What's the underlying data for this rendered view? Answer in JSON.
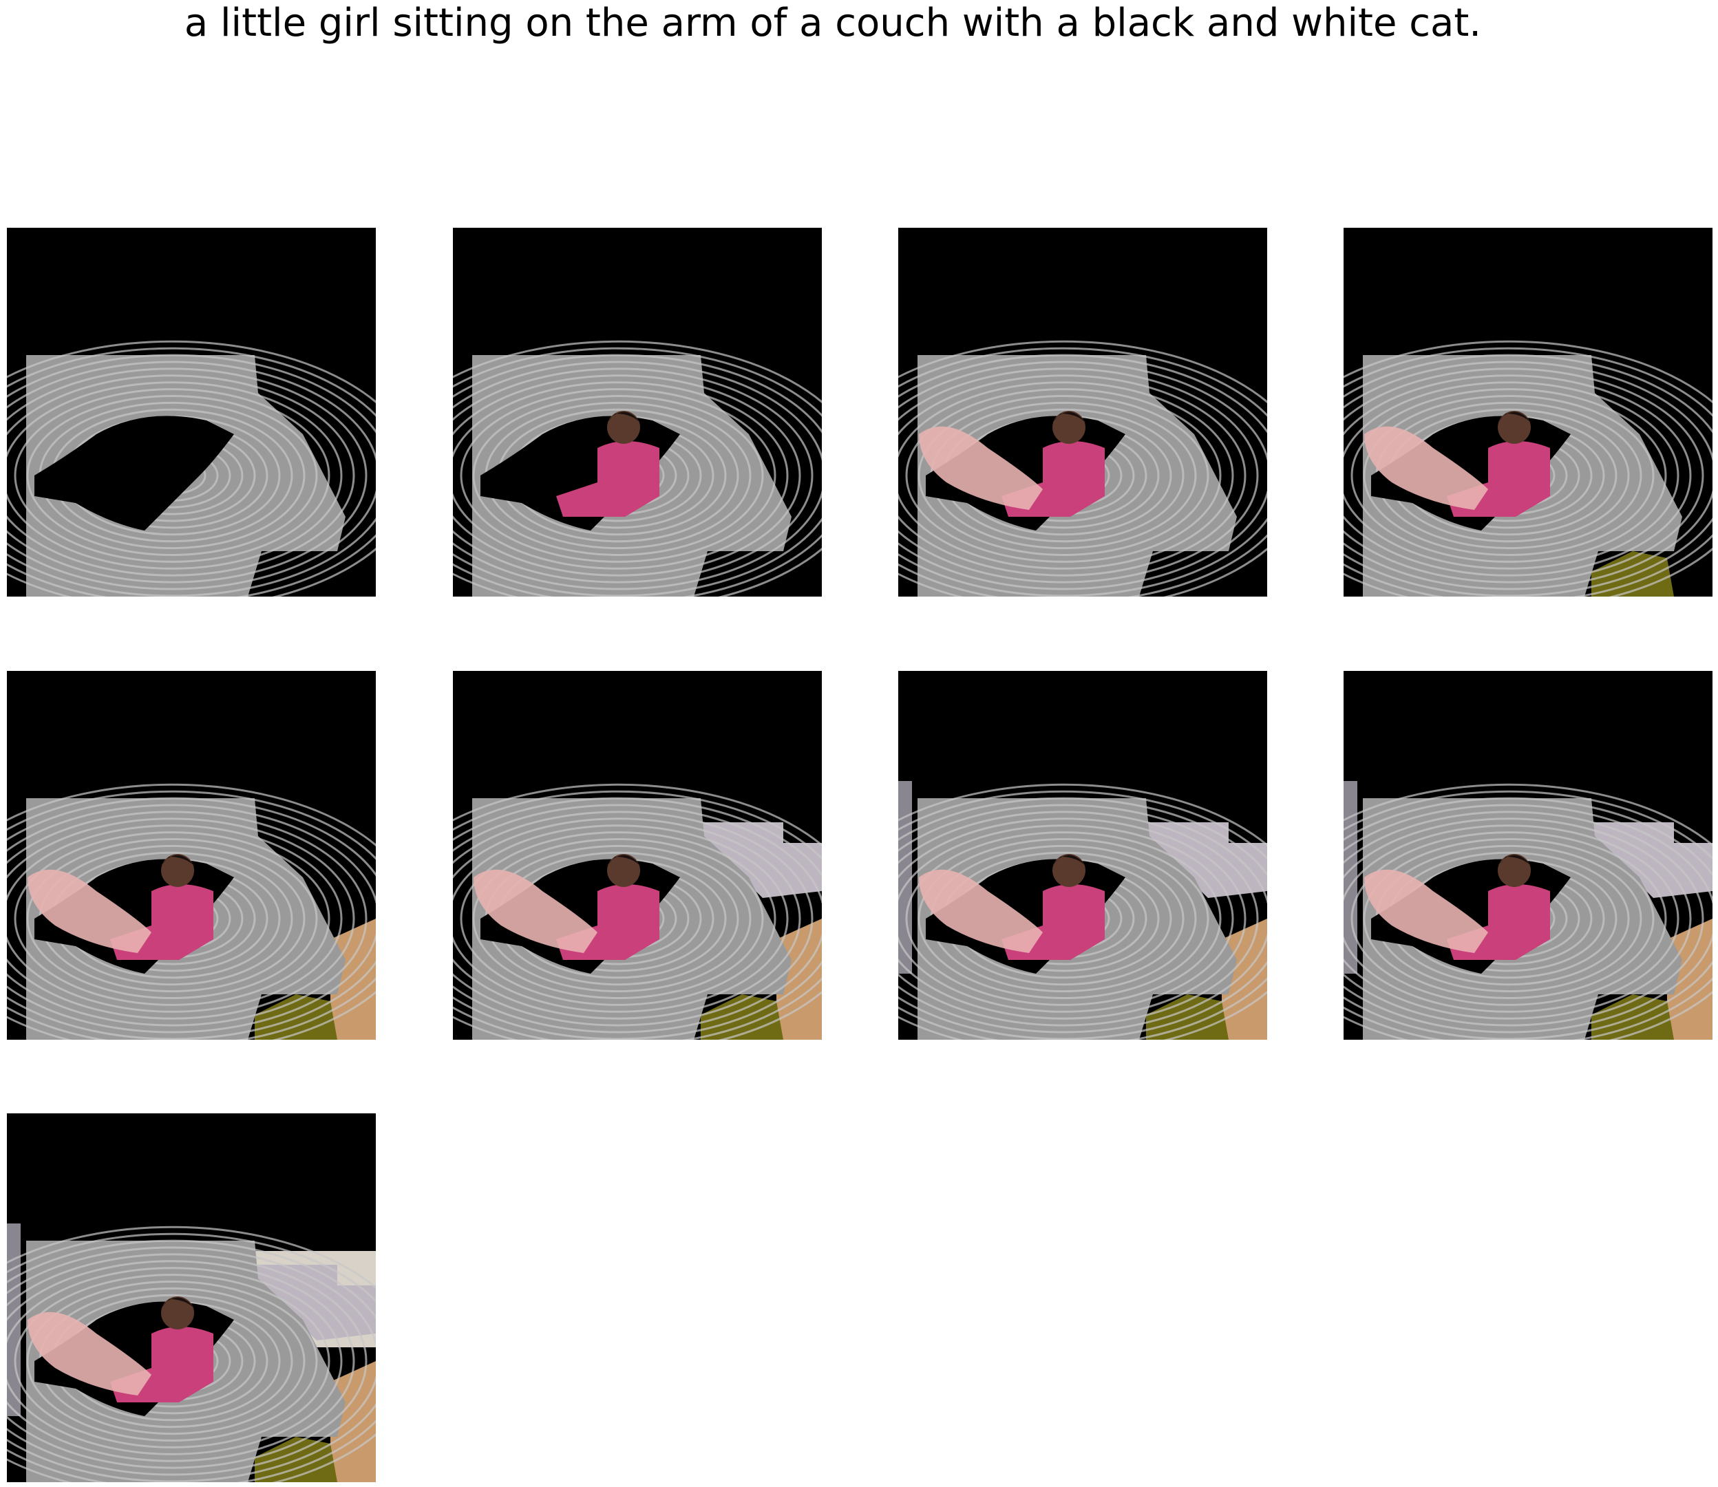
{
  "caption": "a little girl sitting on the arm of a couch with a black and white cat.",
  "panels": [
    {
      "id": "step-1",
      "reveals": [
        "couch"
      ]
    },
    {
      "id": "step-2",
      "reveals": [
        "couch",
        "girl"
      ]
    },
    {
      "id": "step-3",
      "reveals": [
        "couch",
        "girl",
        "arm"
      ]
    },
    {
      "id": "step-4",
      "reveals": [
        "couch",
        "girl",
        "arm",
        "floor"
      ]
    },
    {
      "id": "step-5",
      "reveals": [
        "couch",
        "girl",
        "arm",
        "floor",
        "door"
      ]
    },
    {
      "id": "step-6",
      "reveals": [
        "couch",
        "girl",
        "arm",
        "floor",
        "door",
        "cabinet"
      ]
    },
    {
      "id": "step-7",
      "reveals": [
        "couch",
        "girl",
        "arm",
        "floor",
        "door",
        "cabinet",
        "post"
      ]
    },
    {
      "id": "step-8",
      "reveals": [
        "couch",
        "girl",
        "arm",
        "floor",
        "door",
        "cabinet",
        "post",
        "shadow"
      ]
    },
    {
      "id": "step-9",
      "reveals": [
        "couch",
        "girl",
        "arm",
        "floor",
        "door",
        "cabinet",
        "post",
        "shadow",
        "wall"
      ]
    }
  ],
  "colors": {
    "background": "#000000",
    "couch": "#9a9a9a",
    "girl_outfit": "#c9407a",
    "floor": "#6f6a14"
  }
}
